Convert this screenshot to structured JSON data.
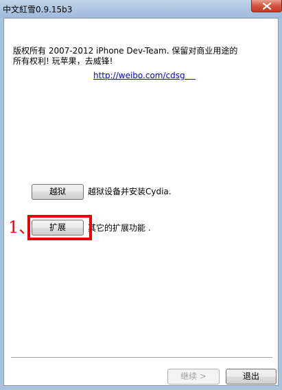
{
  "window": {
    "title": "中文紅雪0.9.15b3",
    "close_icon": "close-icon"
  },
  "content": {
    "copyright_text": "版权所有 2007-2012 iPhone Dev-Team. 保留对商业用途的\n所有权利!   玩苹果，去威锋!",
    "link_text": "http://weibo.com/cdsg    "
  },
  "actions": {
    "jailbreak": {
      "label": "越狱",
      "description": "越狱设备并安装Cydia."
    },
    "extras": {
      "label": "扩展",
      "description": "其它的扩展功能 ."
    }
  },
  "annotation": {
    "label": "1、",
    "color": "#e8000b"
  },
  "footer": {
    "next_label": "继续 >",
    "exit_label": "退出"
  }
}
